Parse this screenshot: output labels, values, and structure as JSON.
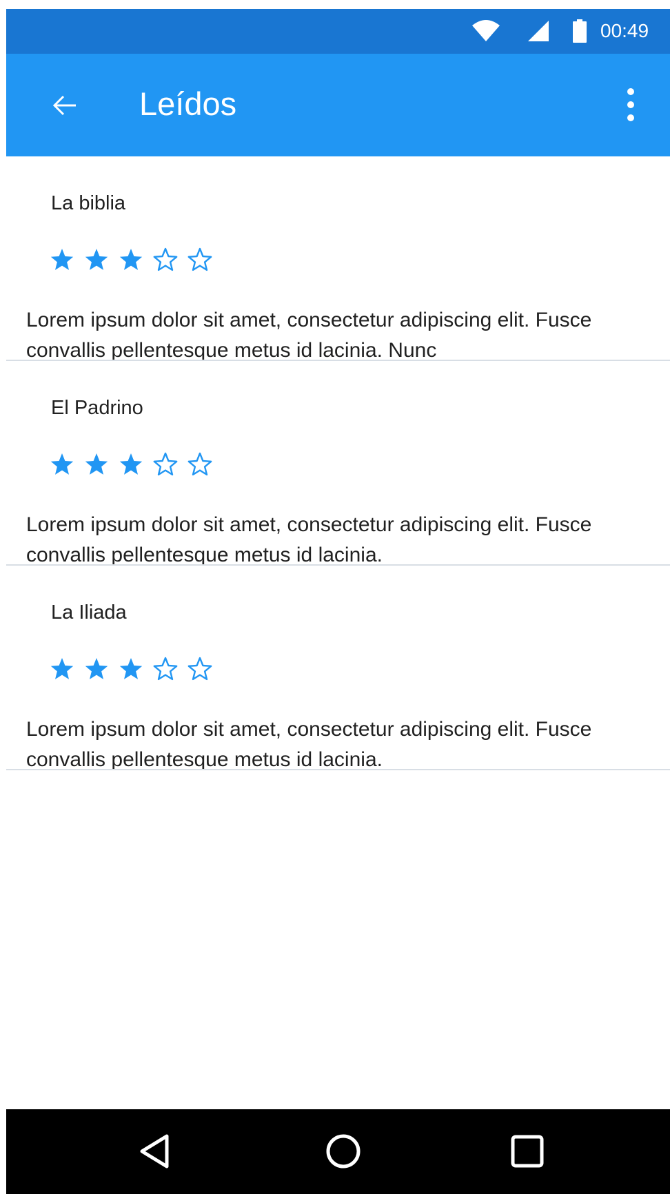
{
  "status_bar": {
    "time": "00:49",
    "background": "#1976D2",
    "icons": [
      "wifi-icon",
      "cell-signal-icon",
      "battery-icon"
    ]
  },
  "app_bar": {
    "title": "Leídos",
    "background": "#2196F3",
    "back_icon": "arrow-back-icon",
    "menu_icon": "more-vert-icon"
  },
  "accent_color": "#2196F3",
  "books": [
    {
      "title": "La biblia",
      "rating": 3,
      "max_rating": 5,
      "description": "Lorem ipsum dolor sit amet, consectetur adipiscing elit. Fusce convallis pellentesque metus id lacinia. Nunc"
    },
    {
      "title": "El Padrino",
      "rating": 3,
      "max_rating": 5,
      "description": "Lorem ipsum dolor sit amet, consectetur adipiscing elit. Fusce convallis pellentesque metus id lacinia."
    },
    {
      "title": "La Iliada",
      "rating": 3,
      "max_rating": 5,
      "description": "Lorem ipsum dolor sit amet, consectetur adipiscing elit. Fusce convallis pellentesque metus id lacinia."
    }
  ],
  "nav_bar": {
    "icons": [
      "nav-back-triangle-icon",
      "nav-home-circle-icon",
      "nav-recents-square-icon"
    ]
  }
}
